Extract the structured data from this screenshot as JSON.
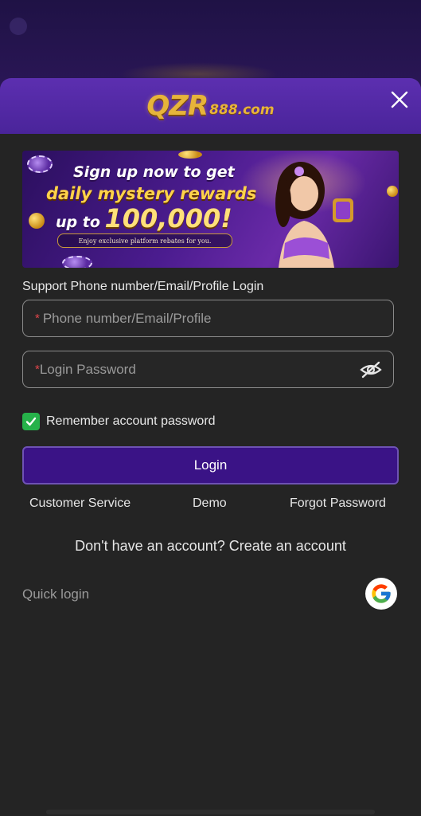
{
  "brand": {
    "logo_main": "QZR",
    "logo_sub": "888.com"
  },
  "banner": {
    "line1": "Sign up now to get",
    "line2": "daily mystery rewards",
    "line3_prefix": "up to",
    "line3_amount": "100,000!",
    "line4": "Enjoy exclusive platform rebates for you."
  },
  "form": {
    "support_label": "Support Phone number/Email/Profile Login",
    "account": {
      "required_mark": "*",
      "placeholder": "Phone number/Email/Profile",
      "value": ""
    },
    "password": {
      "required_mark": "*",
      "placeholder": "Login Password",
      "value": ""
    },
    "remember": {
      "label": "Remember account password",
      "checked": true
    },
    "login_label": "Login"
  },
  "links": {
    "customer_service": "Customer Service",
    "demo": "Demo",
    "forgot_password": "Forgot Password"
  },
  "signup": {
    "prompt": "Don't have an account?",
    "create": "Create an account"
  },
  "quick_login": {
    "label": "Quick login",
    "providers": [
      "google-icon"
    ]
  },
  "colors": {
    "header_purple": "#5c2fb0",
    "login_button": "#3a1386",
    "checkbox_green": "#26b24a",
    "modal_bg": "#242424",
    "required_red": "#e0454a"
  }
}
